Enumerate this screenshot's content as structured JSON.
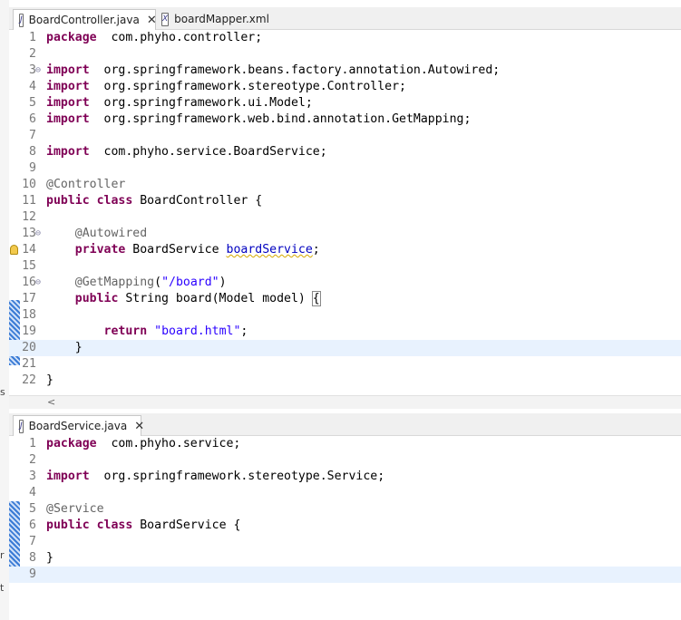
{
  "outer": {
    "marks": [
      "s",
      "r",
      "t"
    ]
  },
  "top_pane": {
    "tabs": [
      {
        "label": "BoardController.java",
        "icon": "J",
        "close": "✕",
        "active": true
      },
      {
        "label": "boardMapper.xml",
        "icon": "X",
        "close": "",
        "active": false
      }
    ],
    "lines": [
      {
        "n": "1",
        "segs": [
          [
            "kw",
            "package"
          ],
          [
            "",
            "  com.phyho.controller;"
          ]
        ]
      },
      {
        "n": "2",
        "segs": []
      },
      {
        "n": "3",
        "fold": "⊖",
        "segs": [
          [
            "kw",
            "import"
          ],
          [
            "",
            "  org.springframework.beans.factory.annotation.Autowired;"
          ]
        ]
      },
      {
        "n": "4",
        "segs": [
          [
            "kw",
            "import"
          ],
          [
            "",
            "  org.springframework.stereotype.Controller;"
          ]
        ]
      },
      {
        "n": "5",
        "segs": [
          [
            "kw",
            "import"
          ],
          [
            "",
            "  org.springframework.ui.Model;"
          ]
        ]
      },
      {
        "n": "6",
        "segs": [
          [
            "kw",
            "import"
          ],
          [
            "",
            "  org.springframework.web.bind.annotation.GetMapping;"
          ]
        ]
      },
      {
        "n": "7",
        "segs": []
      },
      {
        "n": "8",
        "segs": [
          [
            "kw",
            "import"
          ],
          [
            "",
            "  com.phyho.service.BoardService;"
          ]
        ]
      },
      {
        "n": "9",
        "segs": []
      },
      {
        "n": "10",
        "segs": [
          [
            "ann",
            "@Controller"
          ]
        ]
      },
      {
        "n": "11",
        "segs": [
          [
            "kw",
            "public"
          ],
          [
            "",
            " "
          ],
          [
            "kw",
            "class"
          ],
          [
            "",
            " BoardController {"
          ]
        ]
      },
      {
        "n": "12",
        "segs": []
      },
      {
        "n": "13",
        "fold": "⊖",
        "segs": [
          [
            "",
            "    "
          ],
          [
            "ann",
            "@Autowired"
          ]
        ]
      },
      {
        "n": "14",
        "bulb": true,
        "segs": [
          [
            "",
            "    "
          ],
          [
            "kw",
            "private"
          ],
          [
            "",
            " BoardService "
          ],
          [
            "fld",
            "boardService"
          ],
          [
            "",
            ";"
          ]
        ]
      },
      {
        "n": "15",
        "segs": []
      },
      {
        "n": "16",
        "fold": "⊖",
        "segs": [
          [
            "",
            "    "
          ],
          [
            "ann",
            "@GetMapping"
          ],
          [
            "",
            "("
          ],
          [
            "str",
            "\"/board\""
          ],
          [
            "",
            ")"
          ]
        ]
      },
      {
        "n": "17",
        "segs": [
          [
            "",
            "    "
          ],
          [
            "kw",
            "public"
          ],
          [
            "",
            " String board(Model model) "
          ],
          [
            "bracket",
            "{"
          ]
        ]
      },
      {
        "n": "18",
        "segs": []
      },
      {
        "n": "19",
        "segs": [
          [
            "",
            "        "
          ],
          [
            "kw",
            "return"
          ],
          [
            "",
            " "
          ],
          [
            "str",
            "\"board.html\""
          ],
          [
            "",
            ";"
          ]
        ]
      },
      {
        "n": "20",
        "current": true,
        "segs": [
          [
            "",
            "    }"
          ]
        ]
      },
      {
        "n": "21",
        "segs": []
      },
      {
        "n": "22",
        "segs": [
          [
            "",
            "}"
          ]
        ]
      }
    ],
    "scroll_arrow": "<"
  },
  "bottom_pane": {
    "tabs": [
      {
        "label": "BoardService.java",
        "icon": "J",
        "close": "✕",
        "active": true
      }
    ],
    "lines": [
      {
        "n": "1",
        "segs": [
          [
            "kw",
            "package"
          ],
          [
            "",
            "  com.phyho.service;"
          ]
        ]
      },
      {
        "n": "2",
        "segs": []
      },
      {
        "n": "3",
        "segs": [
          [
            "kw",
            "import"
          ],
          [
            "",
            "  org.springframework.stereotype.Service;"
          ]
        ]
      },
      {
        "n": "4",
        "segs": []
      },
      {
        "n": "5",
        "segs": [
          [
            "ann",
            "@Service"
          ]
        ]
      },
      {
        "n": "6",
        "segs": [
          [
            "kw",
            "public"
          ],
          [
            "",
            " "
          ],
          [
            "kw",
            "class"
          ],
          [
            "",
            " BoardService {"
          ]
        ]
      },
      {
        "n": "7",
        "segs": []
      },
      {
        "n": "8",
        "segs": [
          [
            "",
            "}"
          ]
        ]
      },
      {
        "n": "9",
        "current": true,
        "segs": []
      }
    ]
  },
  "colors": {
    "keyword": "#7f0055",
    "annotation": "#646464",
    "string": "#2a00ff",
    "field": "#0000c0",
    "current_line": "#e8f2fe"
  }
}
